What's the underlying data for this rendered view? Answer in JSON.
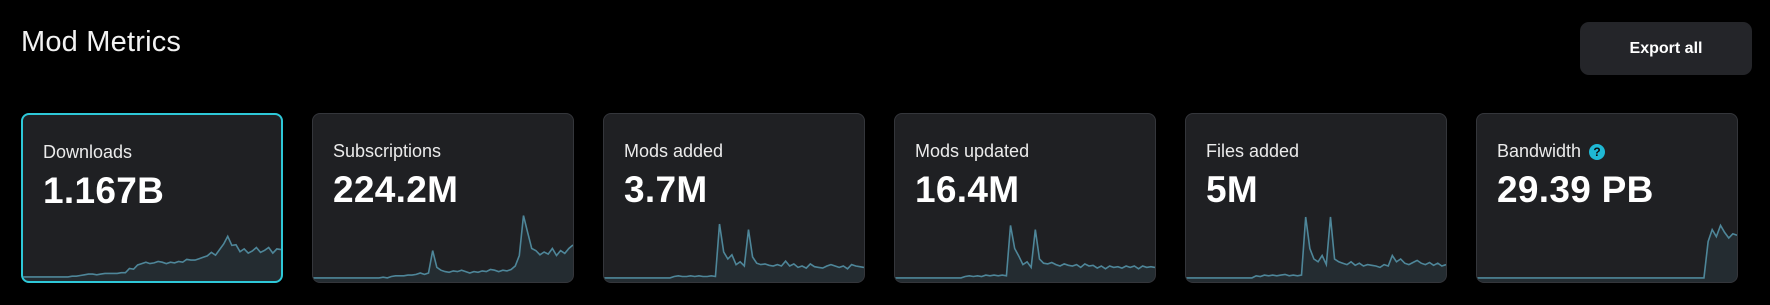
{
  "page": {
    "title": "Mod Metrics",
    "export_label": "Export all"
  },
  "colors": {
    "accent": "#2ec8d8",
    "sparkline_stroke": "#4e8699",
    "help_icon": "#1fb8d4"
  },
  "cards": [
    {
      "label": "Downloads",
      "value": "1.167B",
      "selected": true,
      "help": false,
      "trend": [
        0.03,
        0.03,
        0.03,
        0.03,
        0.03,
        0.03,
        0.03,
        0.03,
        0.03,
        0.03,
        0.03,
        0.03,
        0.04,
        0.04,
        0.05,
        0.06,
        0.07,
        0.07,
        0.06,
        0.07,
        0.08,
        0.08,
        0.08,
        0.08,
        0.09,
        0.09,
        0.15,
        0.14,
        0.2,
        0.22,
        0.24,
        0.22,
        0.23,
        0.25,
        0.24,
        0.22,
        0.24,
        0.23,
        0.25,
        0.24,
        0.28,
        0.27,
        0.27,
        0.29,
        0.31,
        0.33,
        0.38,
        0.34,
        0.42,
        0.5,
        0.61,
        0.48,
        0.49,
        0.39,
        0.43,
        0.37,
        0.4,
        0.45,
        0.38,
        0.41,
        0.45,
        0.37,
        0.43,
        0.42
      ]
    },
    {
      "label": "Subscriptions",
      "value": "224.2M",
      "selected": false,
      "help": false,
      "trend": [
        0.03,
        0.03,
        0.03,
        0.03,
        0.03,
        0.03,
        0.03,
        0.03,
        0.03,
        0.03,
        0.03,
        0.03,
        0.03,
        0.03,
        0.03,
        0.03,
        0.03,
        0.04,
        0.03,
        0.05,
        0.06,
        0.06,
        0.06,
        0.07,
        0.07,
        0.08,
        0.1,
        0.08,
        0.1,
        0.42,
        0.18,
        0.14,
        0.12,
        0.11,
        0.13,
        0.12,
        0.14,
        0.12,
        0.1,
        0.12,
        0.11,
        0.13,
        0.12,
        0.15,
        0.14,
        0.12,
        0.14,
        0.13,
        0.15,
        0.2,
        0.35,
        0.92,
        0.68,
        0.45,
        0.42,
        0.36,
        0.4,
        0.37,
        0.45,
        0.35,
        0.42,
        0.38,
        0.45,
        0.5
      ]
    },
    {
      "label": "Mods added",
      "value": "3.7M",
      "selected": false,
      "help": false,
      "trend": [
        0.03,
        0.03,
        0.03,
        0.03,
        0.03,
        0.03,
        0.03,
        0.03,
        0.03,
        0.03,
        0.03,
        0.03,
        0.03,
        0.03,
        0.03,
        0.03,
        0.03,
        0.05,
        0.06,
        0.05,
        0.05,
        0.06,
        0.05,
        0.06,
        0.05,
        0.05,
        0.06,
        0.05,
        0.8,
        0.4,
        0.3,
        0.36,
        0.22,
        0.26,
        0.2,
        0.72,
        0.33,
        0.24,
        0.22,
        0.23,
        0.21,
        0.2,
        0.22,
        0.2,
        0.27,
        0.2,
        0.23,
        0.18,
        0.2,
        0.17,
        0.23,
        0.19,
        0.18,
        0.17,
        0.2,
        0.22,
        0.2,
        0.18,
        0.2,
        0.16,
        0.22,
        0.2,
        0.19,
        0.18
      ]
    },
    {
      "label": "Mods updated",
      "value": "16.4M",
      "selected": false,
      "help": false,
      "trend": [
        0.03,
        0.03,
        0.03,
        0.03,
        0.03,
        0.03,
        0.03,
        0.03,
        0.03,
        0.03,
        0.03,
        0.03,
        0.03,
        0.03,
        0.03,
        0.03,
        0.03,
        0.05,
        0.06,
        0.05,
        0.06,
        0.05,
        0.07,
        0.06,
        0.07,
        0.06,
        0.07,
        0.06,
        0.78,
        0.45,
        0.34,
        0.22,
        0.26,
        0.18,
        0.72,
        0.3,
        0.24,
        0.23,
        0.25,
        0.22,
        0.2,
        0.23,
        0.21,
        0.2,
        0.22,
        0.18,
        0.23,
        0.2,
        0.21,
        0.17,
        0.2,
        0.16,
        0.2,
        0.18,
        0.19,
        0.17,
        0.2,
        0.18,
        0.2,
        0.16,
        0.2,
        0.18,
        0.19,
        0.18
      ]
    },
    {
      "label": "Files added",
      "value": "5M",
      "selected": false,
      "help": false,
      "trend": [
        0.03,
        0.03,
        0.03,
        0.03,
        0.03,
        0.03,
        0.03,
        0.03,
        0.03,
        0.03,
        0.03,
        0.03,
        0.03,
        0.03,
        0.03,
        0.03,
        0.03,
        0.06,
        0.05,
        0.07,
        0.06,
        0.07,
        0.06,
        0.07,
        0.08,
        0.06,
        0.07,
        0.06,
        0.07,
        0.9,
        0.45,
        0.3,
        0.26,
        0.35,
        0.22,
        0.9,
        0.3,
        0.26,
        0.24,
        0.22,
        0.26,
        0.21,
        0.24,
        0.2,
        0.22,
        0.21,
        0.2,
        0.18,
        0.22,
        0.2,
        0.35,
        0.26,
        0.3,
        0.24,
        0.22,
        0.25,
        0.28,
        0.24,
        0.22,
        0.25,
        0.21,
        0.24,
        0.2,
        0.22
      ]
    },
    {
      "label": "Bandwidth",
      "value": "29.39 PB",
      "selected": false,
      "help": true,
      "trend": [
        0.03,
        0.03,
        0.03,
        0.03,
        0.03,
        0.03,
        0.03,
        0.03,
        0.03,
        0.03,
        0.03,
        0.03,
        0.03,
        0.03,
        0.03,
        0.03,
        0.03,
        0.03,
        0.03,
        0.03,
        0.03,
        0.03,
        0.03,
        0.03,
        0.03,
        0.03,
        0.03,
        0.03,
        0.03,
        0.03,
        0.03,
        0.03,
        0.03,
        0.03,
        0.03,
        0.03,
        0.03,
        0.03,
        0.03,
        0.03,
        0.03,
        0.03,
        0.03,
        0.03,
        0.03,
        0.03,
        0.03,
        0.03,
        0.03,
        0.03,
        0.03,
        0.03,
        0.03,
        0.03,
        0.03,
        0.03,
        0.55,
        0.72,
        0.62,
        0.78,
        0.68,
        0.6,
        0.66,
        0.64
      ]
    }
  ]
}
